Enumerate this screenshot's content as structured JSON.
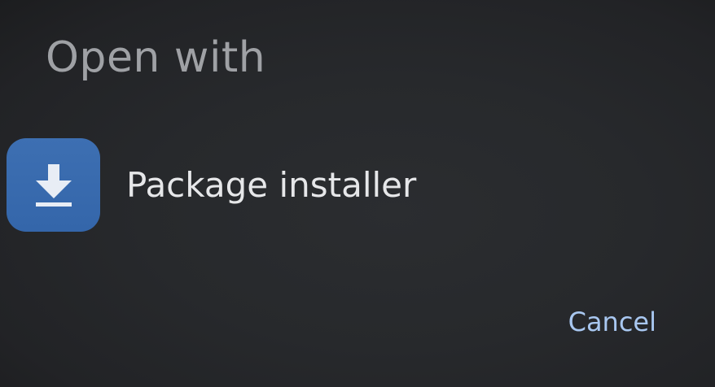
{
  "dialog": {
    "title": "Open with",
    "apps": [
      {
        "label": "Package installer",
        "icon": "download-icon",
        "icon_bg_color": "#3a6cae"
      }
    ],
    "cancel_label": "Cancel"
  },
  "colors": {
    "background": "#27292c",
    "title_text": "#9fa1a5",
    "app_text": "#e6e7e9",
    "accent": "#a8c7f0"
  }
}
